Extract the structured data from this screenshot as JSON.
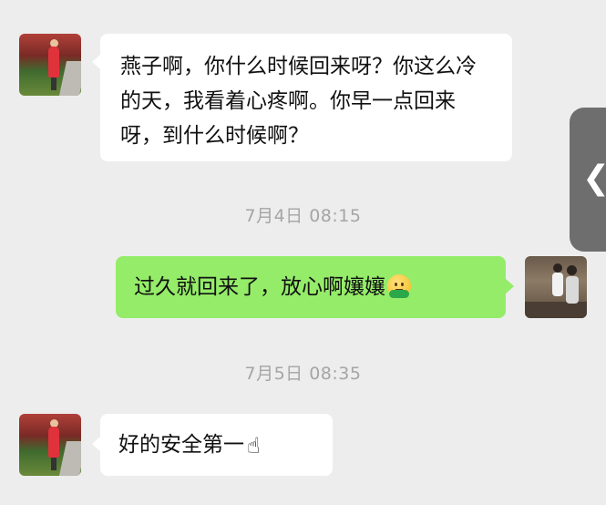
{
  "messages": [
    {
      "side": "left",
      "text": "燕子啊，你什么时候回来呀？你这么冷的天，我看着心疼啊。你早一点回来呀，到什么时候啊？"
    },
    {
      "side": "right",
      "text": "过久就回来了，放心啊孃孃",
      "emoji": "smiling-hands-emoji"
    },
    {
      "side": "left",
      "text": "好的安全第一",
      "emoji": "☝"
    }
  ],
  "timestamps": [
    "7月4日 08:15",
    "7月5日 08:35"
  ],
  "side_handle": {
    "icon": "chevron-left-icon",
    "glyph": "❮"
  },
  "colors": {
    "background": "#ededed",
    "bubble_received": "#ffffff",
    "bubble_sent": "#95ec69",
    "timestamp": "#a5a5a5"
  }
}
